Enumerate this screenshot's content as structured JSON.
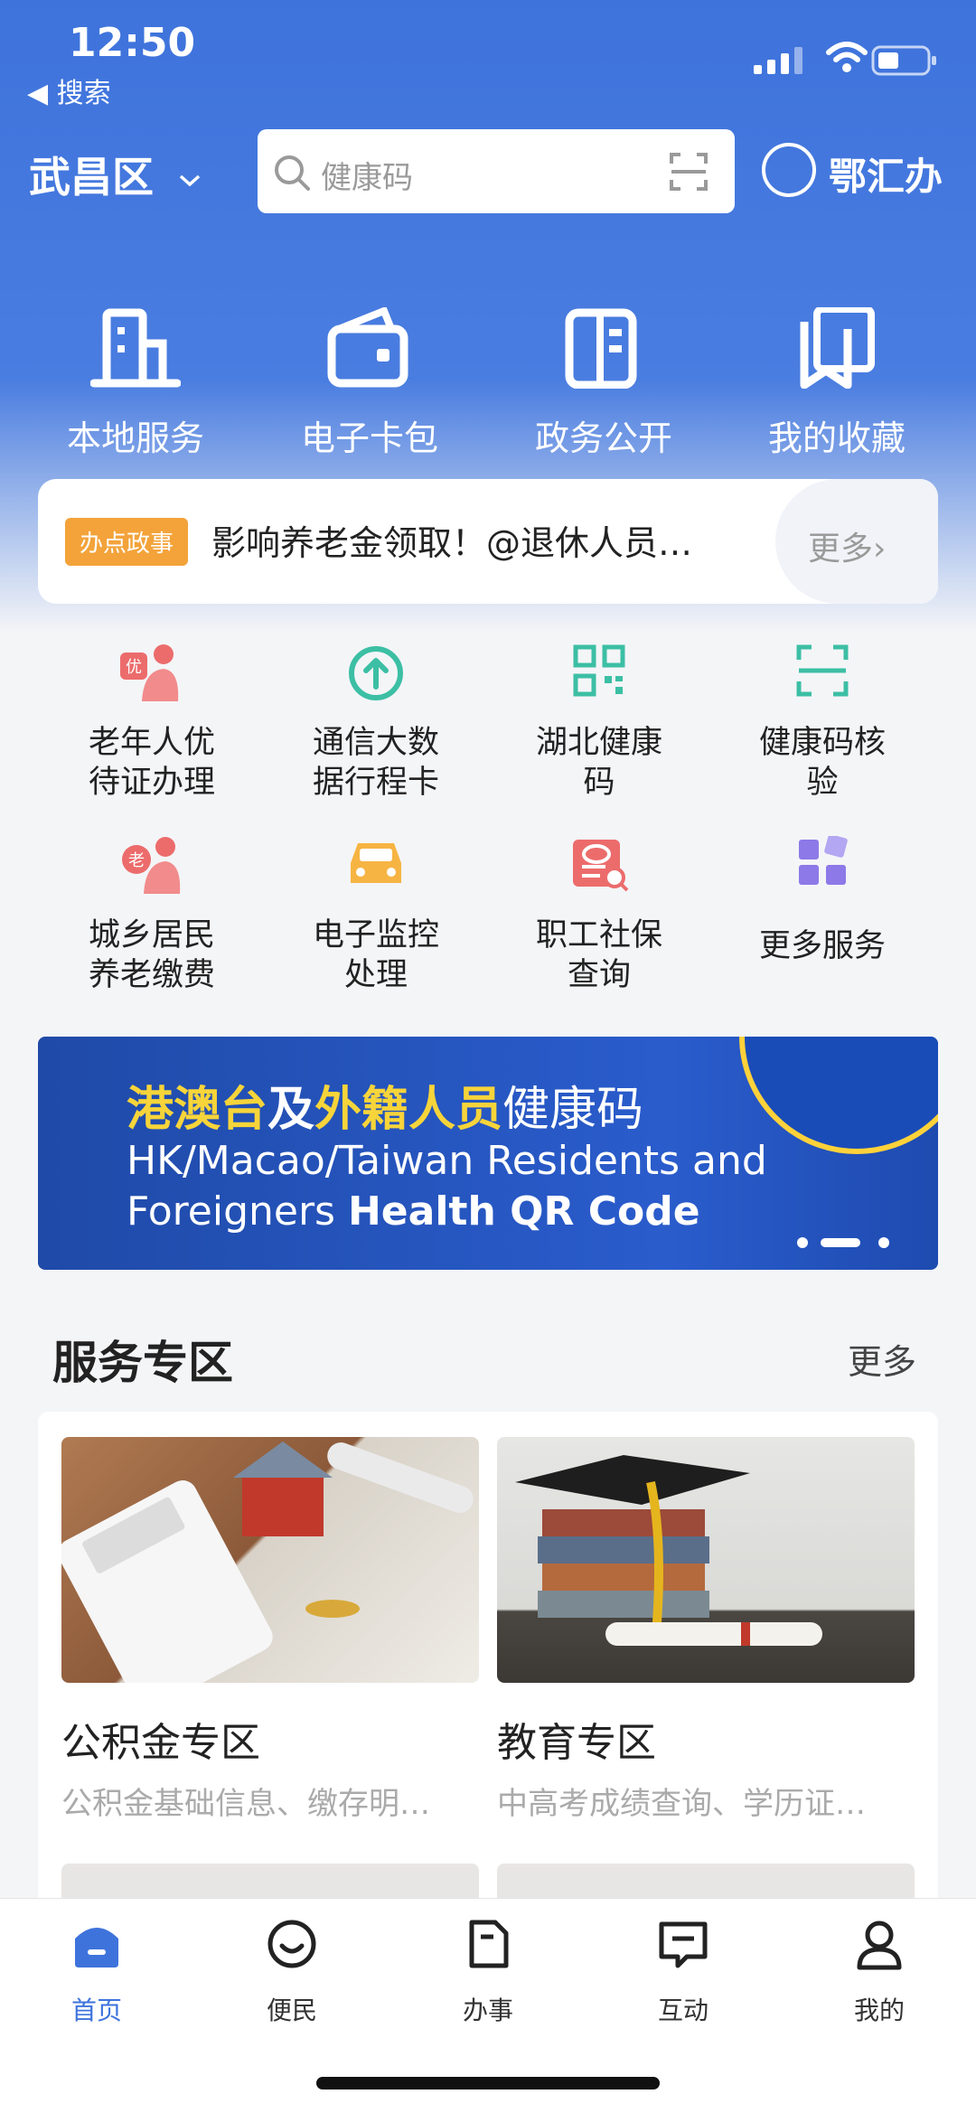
{
  "status": {
    "time": "12:50",
    "back_label": "◀ 搜索"
  },
  "header": {
    "district": "武昌区",
    "search_placeholder": "健康码",
    "brand": "鄂汇办"
  },
  "top_services": [
    {
      "label": "本地服务",
      "icon": "building-icon"
    },
    {
      "label": "电子卡包",
      "icon": "wallet-icon"
    },
    {
      "label": "政务公开",
      "icon": "document-icon"
    },
    {
      "label": "我的收藏",
      "icon": "bookmark-icon"
    }
  ],
  "notice": {
    "badge": "办点政事",
    "text": "影响养老金领取！@退休人员…",
    "more": "更多›"
  },
  "grid": [
    {
      "label": "老年人优待证办理",
      "icon": "elderly-icon"
    },
    {
      "label": "通信大数据行程卡",
      "icon": "upload-arrow-icon"
    },
    {
      "label": "湖北健康码",
      "icon": "qr-code-icon"
    },
    {
      "label": "健康码核验",
      "icon": "scan-icon"
    },
    {
      "label": "城乡居民养老缴费",
      "icon": "pension-icon"
    },
    {
      "label": "电子监控处理",
      "icon": "car-icon"
    },
    {
      "label": "职工社保查询",
      "icon": "social-security-icon"
    },
    {
      "label": "更多服务",
      "icon": "more-apps-icon"
    }
  ],
  "banner": {
    "line1_a": "港澳台",
    "line1_b": "及",
    "line1_c": "外籍人员",
    "line1_d": "健康码",
    "line2": "HK/Macao/Taiwan Residents and",
    "line3_a": "Foreigners ",
    "line3_b": "Health QR Code"
  },
  "zone": {
    "title": "服务专区",
    "more": "更多",
    "cards": [
      {
        "title": "公积金专区",
        "subtitle": "公积金基础信息、缴存明…"
      },
      {
        "title": "教育专区",
        "subtitle": "中高考成绩查询、学历证…"
      }
    ]
  },
  "tabs": [
    {
      "label": "首页",
      "icon": "home-icon",
      "active": true
    },
    {
      "label": "便民",
      "icon": "smile-icon",
      "active": false
    },
    {
      "label": "办事",
      "icon": "file-icon",
      "active": false
    },
    {
      "label": "互动",
      "icon": "chat-icon",
      "active": false
    },
    {
      "label": "我的",
      "icon": "user-icon",
      "active": false
    }
  ],
  "colors": {
    "primary": "#3e73dc",
    "badge": "#f3a33a",
    "banner_yellow": "#f7d43a"
  }
}
